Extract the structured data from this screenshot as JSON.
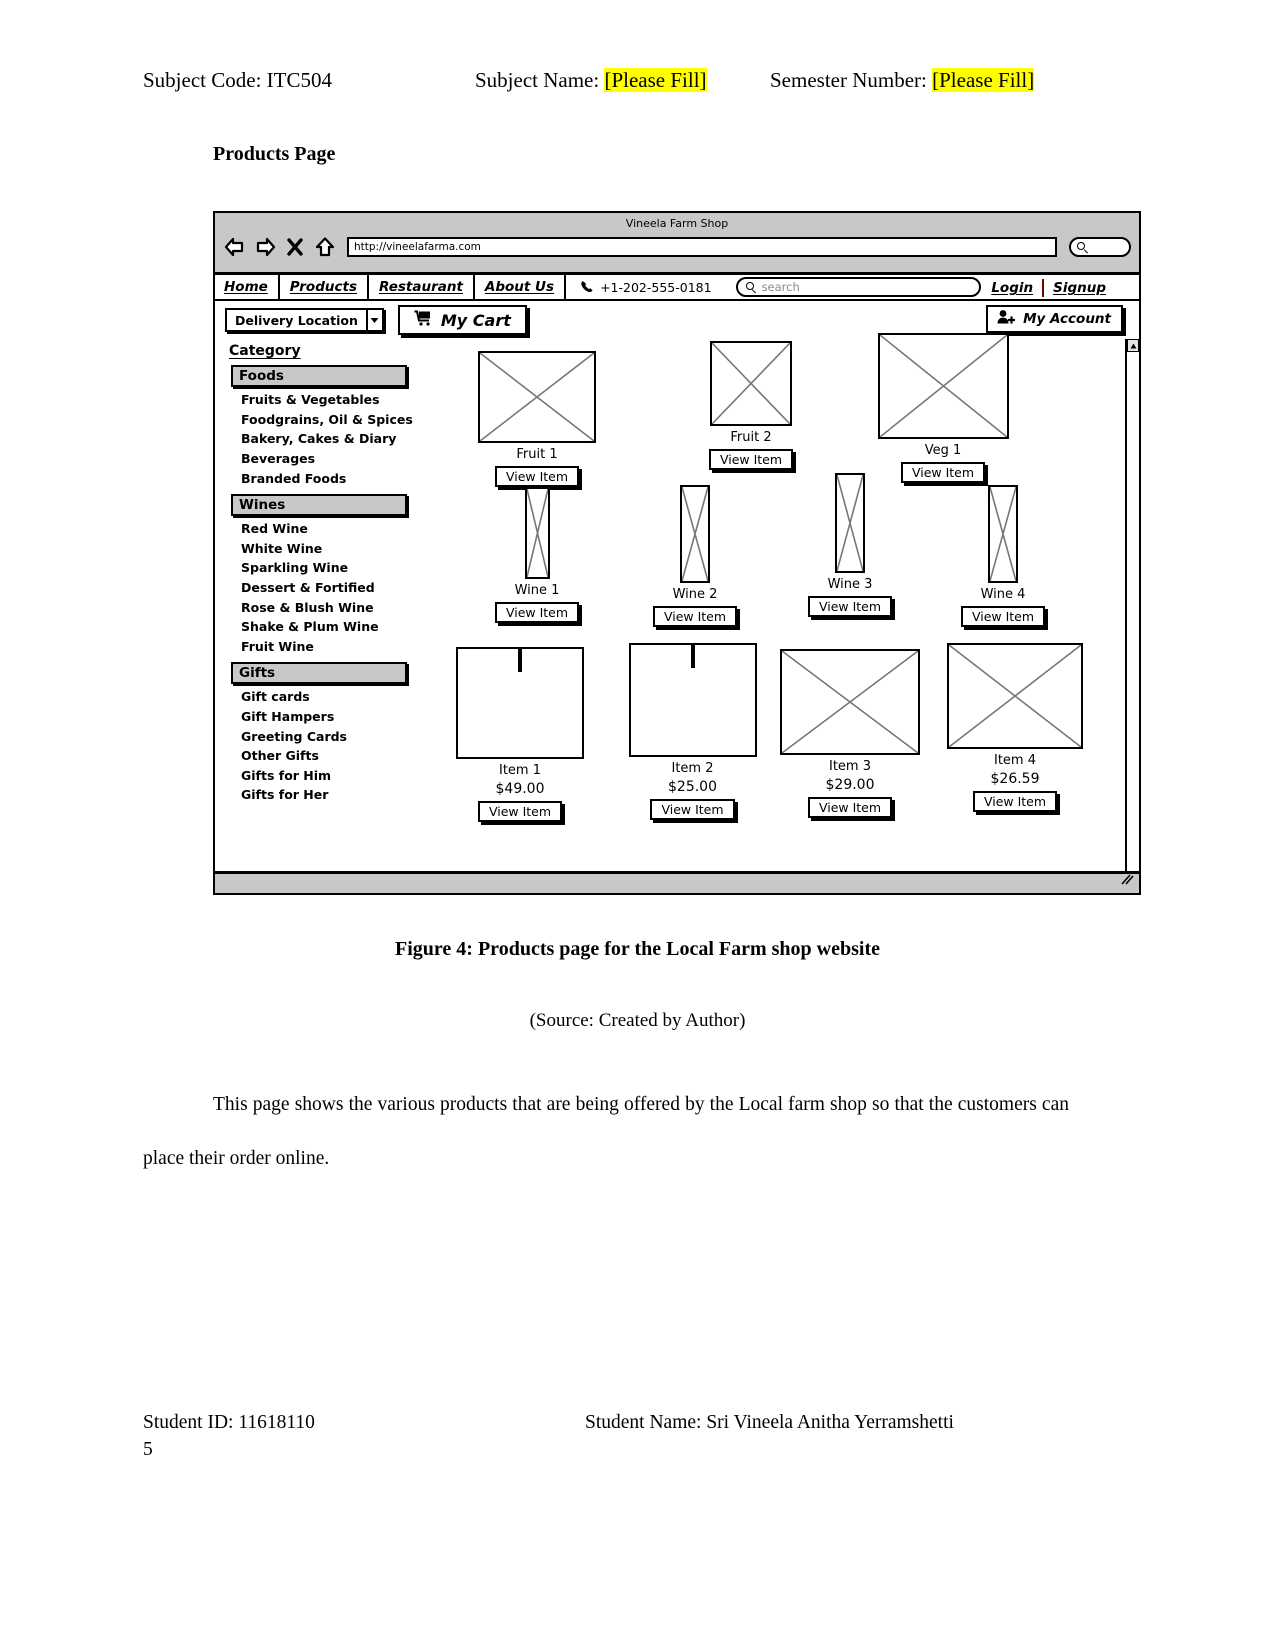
{
  "document": {
    "header": {
      "subject_code_label": "Subject Code: ITC504",
      "subject_name_label": "Subject Name:",
      "subject_name_value": "[Please Fill]",
      "semester_label": "Semester Number:",
      "semester_value": "[Please Fill]",
      "highlight_color": "#ffff00"
    },
    "page_heading": "Products Page",
    "figure_caption": "Figure 4: Products page for the Local Farm shop website",
    "figure_source": "(Source: Created by Author)",
    "paragraph": "This page shows the various products that are being offered by the Local farm shop so that the customers can place their order online.",
    "footer": {
      "student_id": "Student ID:  11618110",
      "student_id_cont": "5",
      "student_name": "Student  Name:  Sri  Vineela  Anitha  Yerramshetti"
    }
  },
  "wireframe": {
    "browser": {
      "window_title": "Vineela Farm Shop",
      "url": "http://vineelafarma.com",
      "back_icon": "back-arrow-icon",
      "forward_icon": "forward-arrow-icon",
      "stop_icon": "stop-x-icon",
      "home_icon": "home-icon",
      "search_icon": "magnifier-icon"
    },
    "navbar": {
      "menu": [
        {
          "label": "Home"
        },
        {
          "label": "Products"
        },
        {
          "label": "Restaurant"
        },
        {
          "label": "About Us"
        }
      ],
      "phone": "+1-202-555-0181",
      "phone_icon": "phone-icon",
      "search_placeholder": "search",
      "search_icon": "magnifier-icon",
      "login": "Login",
      "signup": "Signup"
    },
    "toolbar": {
      "delivery_location": "Delivery Location",
      "delivery_dropdown_icon": "chevron-down-icon",
      "cart_label": "My Cart",
      "cart_icon": "shopping-cart-icon",
      "account_label": "My Account",
      "account_icon": "add-user-icon"
    },
    "sidebar": {
      "title": "Category",
      "groups": [
        {
          "label": "Foods",
          "items": [
            "Fruits & Vegetables",
            "Foodgrains, Oil & Spices",
            "Bakery, Cakes & Diary",
            "Beverages",
            "Branded Foods"
          ]
        },
        {
          "label": "Wines",
          "items": [
            "Red Wine",
            "White Wine",
            "Sparkling Wine",
            "Dessert & Fortified",
            "Rose & Blush Wine",
            "Shake & Plum Wine",
            "Fruit Wine"
          ]
        },
        {
          "label": "Gifts",
          "items": [
            "Gift cards",
            "Gift Hampers",
            "Greeting Cards",
            "Other Gifts",
            "Gifts for Him",
            "Gifts for Her"
          ]
        }
      ]
    },
    "products": {
      "view_item_label": "View Item",
      "row1": [
        {
          "name": "Fruit 1",
          "price": ""
        },
        {
          "name": "Fruit 2",
          "price": ""
        },
        {
          "name": "Veg 1",
          "price": ""
        }
      ],
      "row2": [
        {
          "name": "Wine 1",
          "price": ""
        },
        {
          "name": "Wine 2",
          "price": ""
        },
        {
          "name": "Wine 3",
          "price": ""
        },
        {
          "name": "Wine 4",
          "price": ""
        }
      ],
      "row3": [
        {
          "name": "Item 1",
          "price": "$49.00"
        },
        {
          "name": "Item 2",
          "price": "$25.00"
        },
        {
          "name": "Item 3",
          "price": "$29.00"
        },
        {
          "name": "Item 4",
          "price": "$26.59"
        }
      ]
    },
    "scrollbar": {
      "up_icon": "scroll-up-icon",
      "down_icon": "scroll-down-icon"
    },
    "resize_handle_icon": "resize-grip-icon"
  }
}
